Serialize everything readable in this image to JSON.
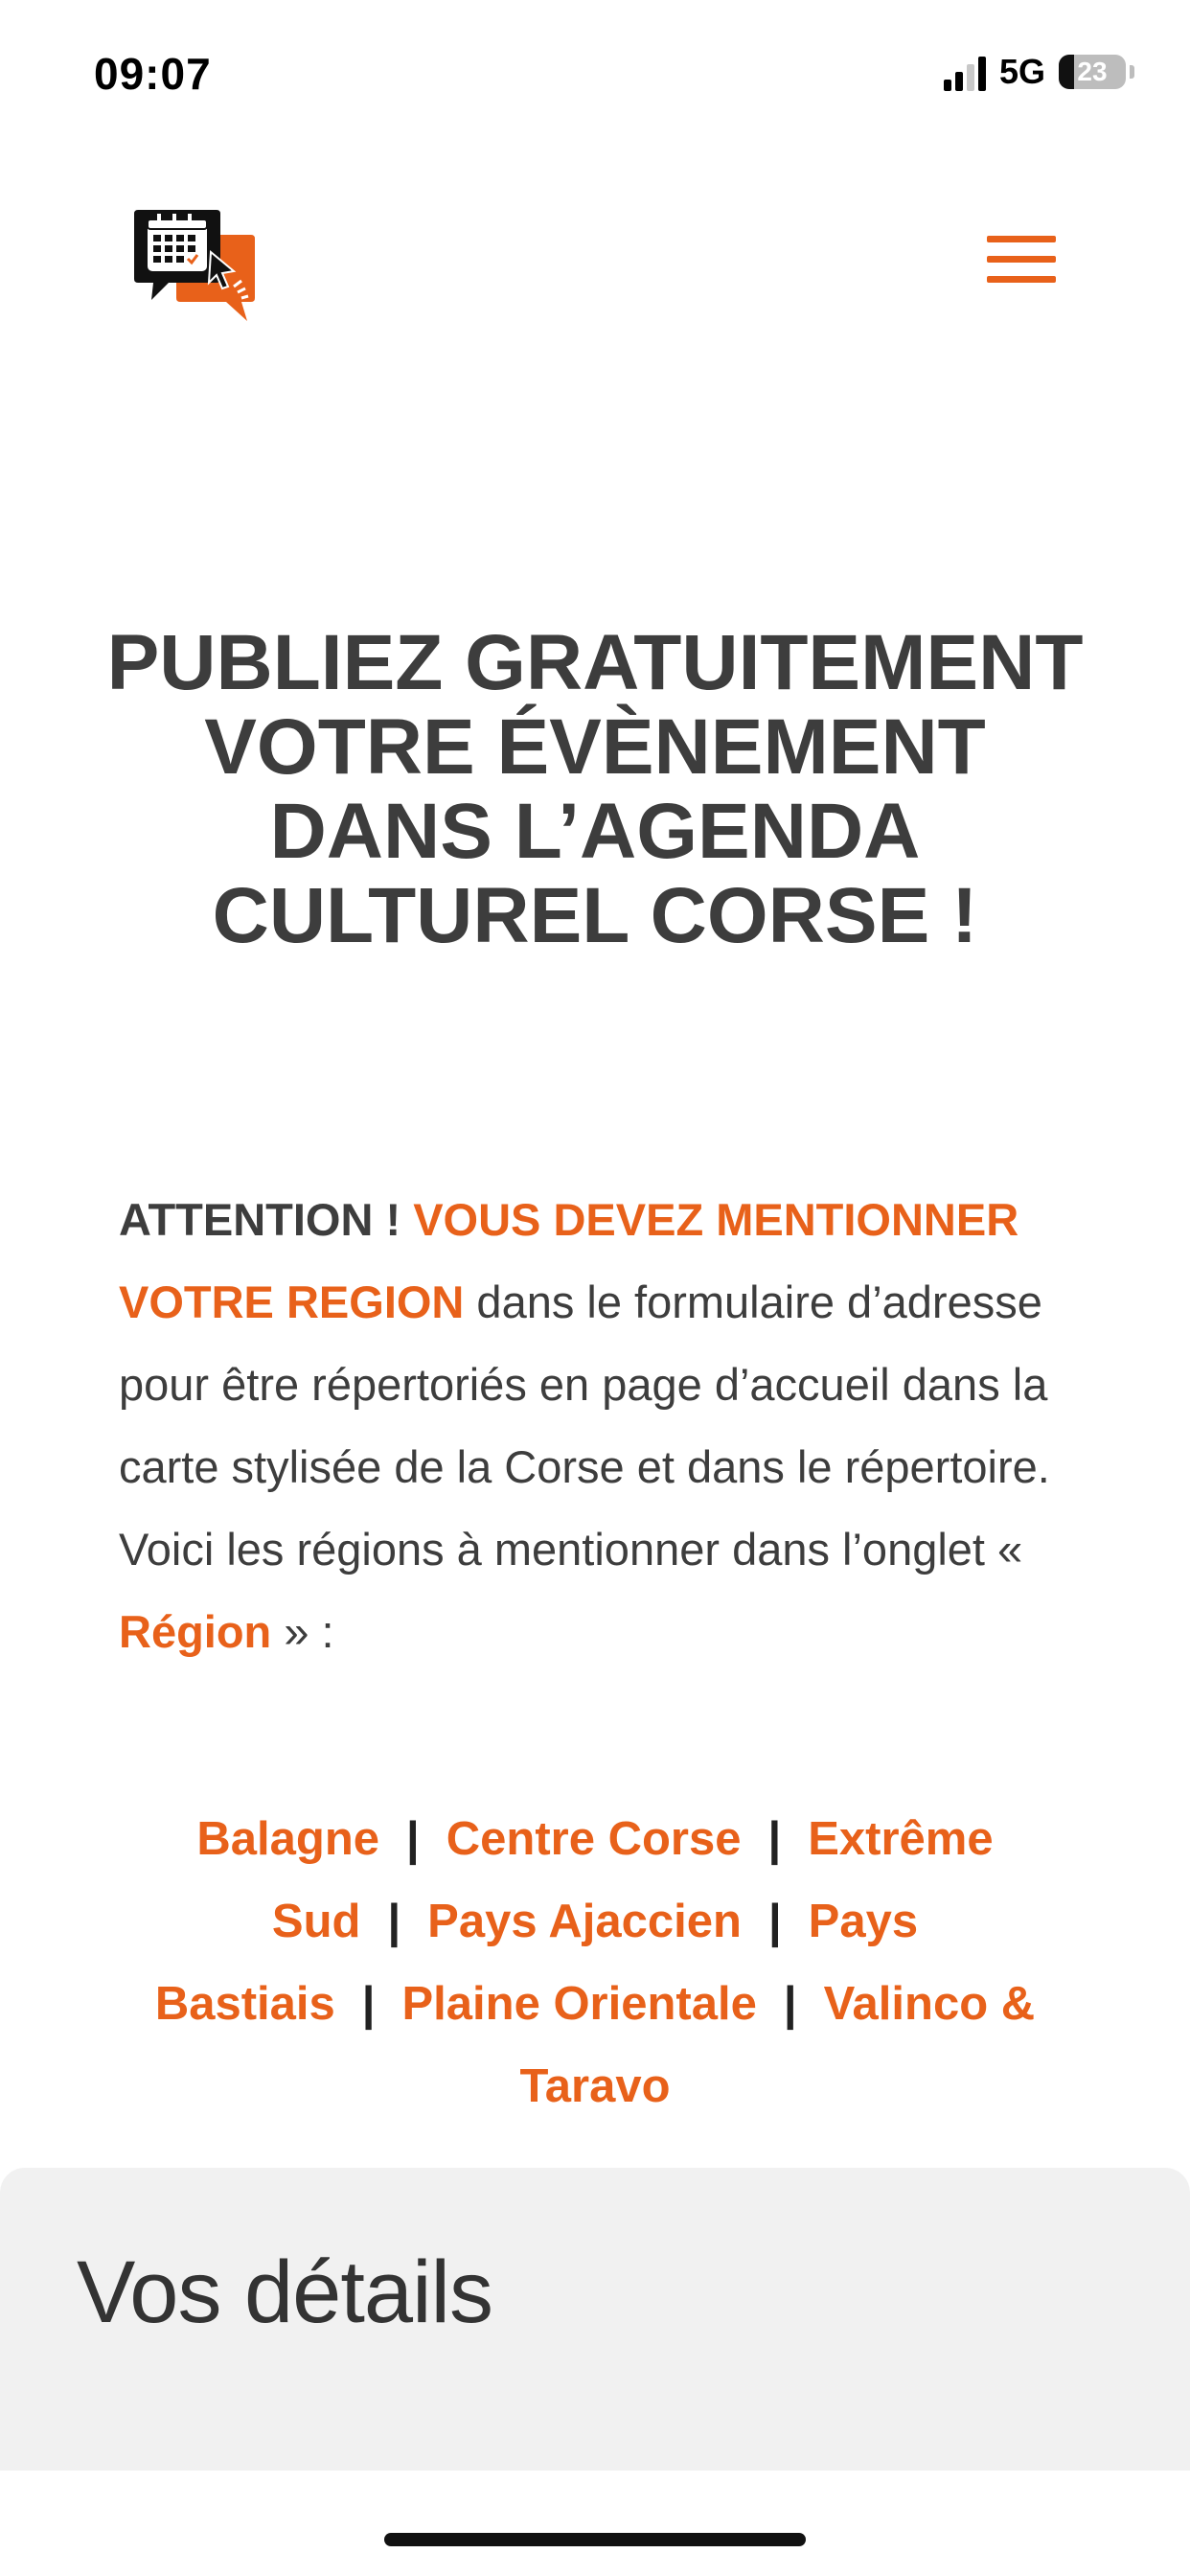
{
  "status_bar": {
    "time": "09:07",
    "network": "5G",
    "battery": "23",
    "battery_level": 0.23
  },
  "header": {
    "logo_icon": "calendar-chat-logo",
    "menu_icon": "hamburger-menu-icon",
    "accent_color": "#e8611a"
  },
  "main": {
    "title": "PUBLIEZ GRATUITEMENT VOTRE ÉVÈNEMENT DANS L’AGENDA CULTUREL CORSE !",
    "notice": {
      "attention": "ATTENTION ! ",
      "must_mention": "VOUS DEVEZ MENTIONNER VOTRE REGION",
      "text_1": " dans le formulaire d’adresse pour être répertoriés en page d’accueil dans la carte stylisée de la Corse et dans le répertoire. Voici les régions à mentionner dans l’onglet « ",
      "region_word": "Région",
      "text_2": " » :"
    },
    "regions": [
      "Balagne",
      "Centre Corse",
      "Extrême Sud",
      "Pays Ajaccien",
      "Pays Bastiais",
      "Plaine Orientale",
      "Valinco & Taravo"
    ],
    "separator": "|"
  },
  "details": {
    "title": "Vos détails"
  }
}
